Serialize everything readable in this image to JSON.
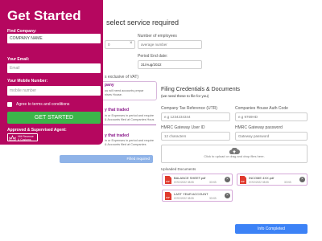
{
  "background_form": {
    "heading": "select service required",
    "employees_label": "Number of employees",
    "employees_placeholder": "average number",
    "field_left_value": "0",
    "period_end_label": "Period End date:",
    "period_end_value": "31/Aug/2022",
    "vat_text": "s exclusive of VAT)",
    "sec1_title": "pany",
    "sec1_line1": "ou will need accounts prepar",
    "sec1_line2": "nises House.",
    "sec2_title": "y that traded",
    "sec2_line1": "in or Expenses in period and require",
    "sec2_line2": "& Accounts filed at Companies Hous",
    "sec3_title": "y that traded",
    "sec3_line1": "in or Expenses in period and require",
    "sec3_line2": "& Accounts filed at Companies",
    "continue_label": "Filled required"
  },
  "filing": {
    "title": "Filing Credentials & Documents",
    "subtitle": "(we need these to file for you)",
    "tax_ref_label": "Company Tax Reference (UTR)",
    "tax_ref_placeholder": "e.g 1234234344",
    "auth_code_label": "Companies House Auth Code",
    "auth_code_placeholder": "e.g 9769HD",
    "gateway_user_label": "HMRC Gateway User ID",
    "gateway_user_placeholder": "12 characters",
    "gateway_pass_label": "HMRC Gateway password",
    "gateway_pass_placeholder": "Gateway password",
    "drop_text": "Click to upload or drag and drop files here.",
    "uploaded_label": "Uploaded Documents",
    "files": [
      {
        "name": "BALANCE SHEET.pdf",
        "date": "07/02/2022 08:55",
        "size": "30 KB"
      },
      {
        "name": "INCOME 4XX.pdf",
        "date": "07/02/2022 08:55",
        "size": "30 KB"
      },
      {
        "name": "LAST YEAR ACCOUNT",
        "date": "07/02/2022 08:55",
        "size": "30 KB"
      }
    ],
    "info_button": "Info Completed"
  },
  "get_started": {
    "title": "Get Started",
    "company_label": "Find Company:",
    "company_value": "COMPANY NAME",
    "email_label": "Your Email:",
    "email_placeholder": "Email",
    "mobile_label": "Your Mobile Number:",
    "mobile_placeholder": "mobile number",
    "terms_label": "Agree to terms and conditions",
    "submit_label": "GET STARTED",
    "agent_label": "Approved & Supervised Agent:",
    "logo_line1": "HM Revenue",
    "logo_line2": "& Customs"
  },
  "colors": {
    "brand": "#b5075f",
    "primary_button": "#3cb54a",
    "info_button": "#3c82f6"
  }
}
